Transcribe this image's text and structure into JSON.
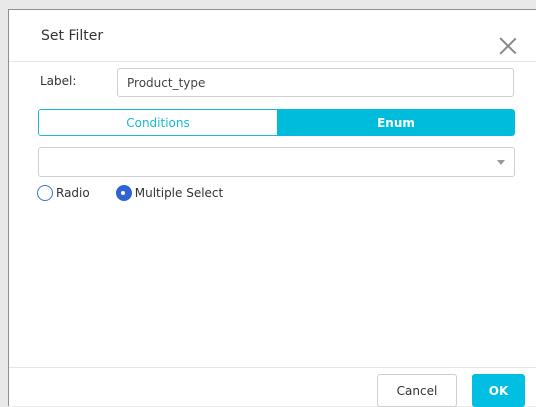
{
  "dialog": {
    "title": "Set Filter"
  },
  "label_field": {
    "label": "Label:",
    "value": "Product_type"
  },
  "tabs": [
    {
      "label": "Conditions",
      "active": false
    },
    {
      "label": "Enum",
      "active": true
    }
  ],
  "enum_select": {
    "value": ""
  },
  "selection_mode": {
    "options": [
      {
        "label": "Radio",
        "checked": false
      },
      {
        "label": "Multiple Select",
        "checked": true
      }
    ]
  },
  "footer": {
    "cancel_label": "Cancel",
    "ok_label": "OK"
  },
  "colors": {
    "accent": "#00bcdc",
    "radio_selected": "#2f63d3"
  }
}
